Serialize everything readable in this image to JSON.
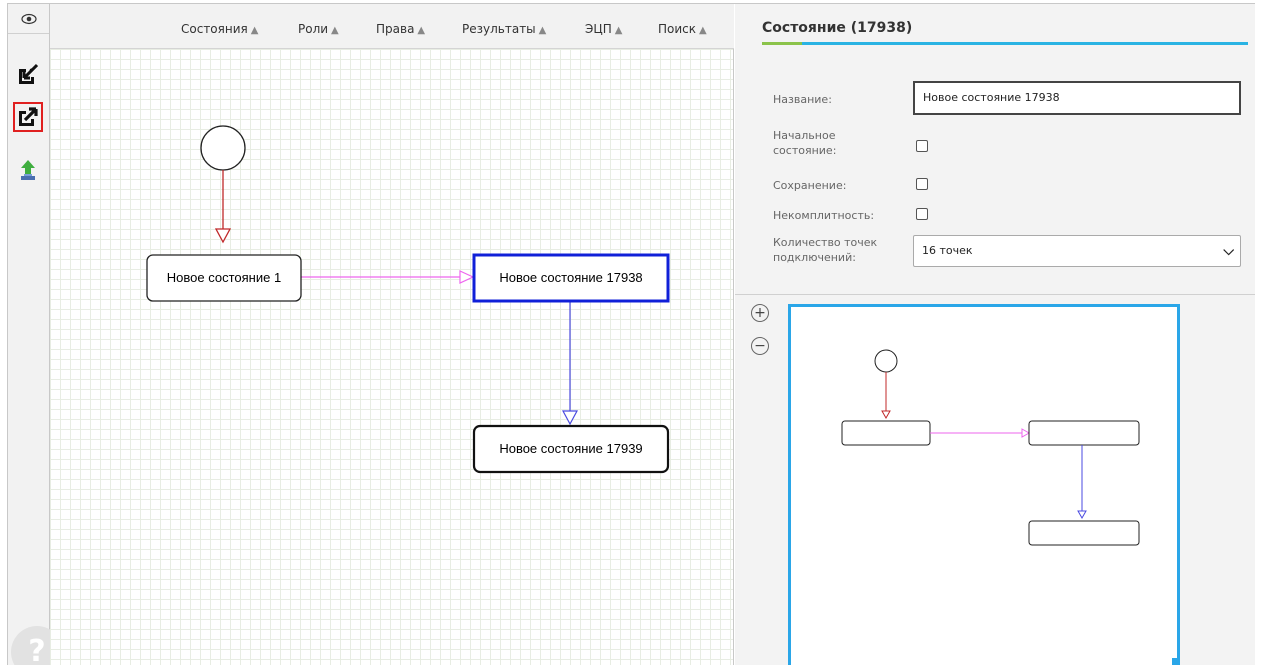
{
  "menu": {
    "items": [
      {
        "label": "Состояния"
      },
      {
        "label": "Роли"
      },
      {
        "label": "Права"
      },
      {
        "label": "Результаты"
      },
      {
        "label": "ЭЦП"
      },
      {
        "label": "Поиск"
      }
    ]
  },
  "icons": {
    "eye": "eye-icon",
    "import": "import-icon",
    "export": "export-icon",
    "upload": "upload-icon",
    "help": "help-icon",
    "caret": "chevron-up-icon"
  },
  "help": {
    "label": "?"
  },
  "diagram": {
    "states": [
      {
        "id": "1",
        "label": "Новое состояние 1",
        "selected": false
      },
      {
        "id": "17938",
        "label": "Новое состояние 17938",
        "selected": true
      },
      {
        "id": "17939",
        "label": "Новое состояние 17939",
        "selected": false
      }
    ],
    "colors": {
      "start_transition": "#c0282a",
      "transition_1_to_17938": "#ee66ee",
      "transition_17938_to_17939": "#4a4ae0",
      "selected_border": "#1020d8"
    }
  },
  "panel": {
    "title": "Состояние (17938)",
    "name_label": "Название:",
    "name_value": "Новое состояние 17938",
    "initial_label_1": "Начальное",
    "initial_label_2": "состояние:",
    "initial_checked": false,
    "save_label": "Сохранение:",
    "save_checked": false,
    "incomplete_label": "Некомплитность:",
    "incomplete_checked": false,
    "points_label_1": "Количество точек",
    "points_label_2": "подключений:",
    "points_value": "16 точек"
  },
  "zoom": {
    "in": "+",
    "out": "−"
  }
}
